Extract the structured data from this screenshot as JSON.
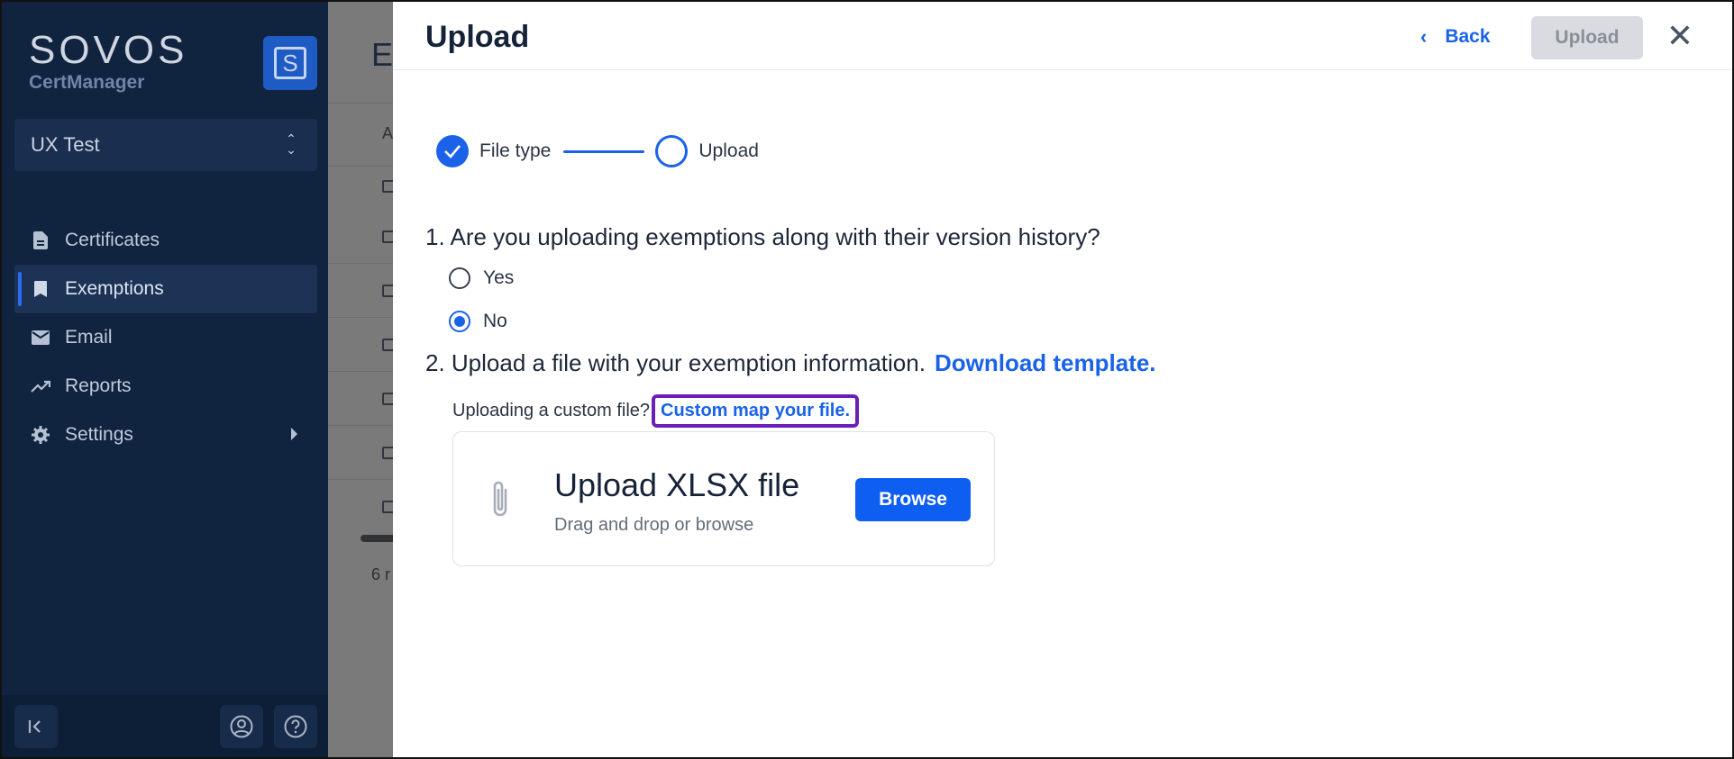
{
  "sidebar": {
    "brand": "SOVOS",
    "product": "CertManager",
    "badge_letter": "S",
    "org_name": "UX Test",
    "items": [
      {
        "label": "Certificates",
        "icon": "document-icon"
      },
      {
        "label": "Exemptions",
        "icon": "bookmark-icon",
        "active": true
      },
      {
        "label": "Email",
        "icon": "mail-icon"
      },
      {
        "label": "Reports",
        "icon": "trend-icon"
      },
      {
        "label": "Settings",
        "icon": "gear-icon"
      }
    ]
  },
  "background": {
    "title_partial": "E",
    "tab_partial": "A",
    "footer_partial": "6 r"
  },
  "panel": {
    "title": "Upload",
    "back_label": "Back",
    "upload_label": "Upload",
    "close_glyph": "✕",
    "steps": [
      {
        "label": "File type",
        "status": "complete"
      },
      {
        "label": "Upload",
        "status": "current"
      }
    ],
    "question1": "1. Are you uploading exemptions along with their version history?",
    "options": [
      {
        "label": "Yes",
        "selected": false
      },
      {
        "label": "No",
        "selected": true
      }
    ],
    "question2": "2. Upload a file with your exemption information.",
    "download_link": "Download template.",
    "custom_question": "Uploading a custom file?",
    "custom_link": "Custom map your file.",
    "dropzone": {
      "title": "Upload XLSX file",
      "subtitle": "Drag and drop or browse",
      "browse_label": "Browse"
    }
  },
  "colors": {
    "accent": "#1a63e8",
    "sidebar_bg": "#10233f",
    "highlight_border": "#6a1fb8"
  }
}
